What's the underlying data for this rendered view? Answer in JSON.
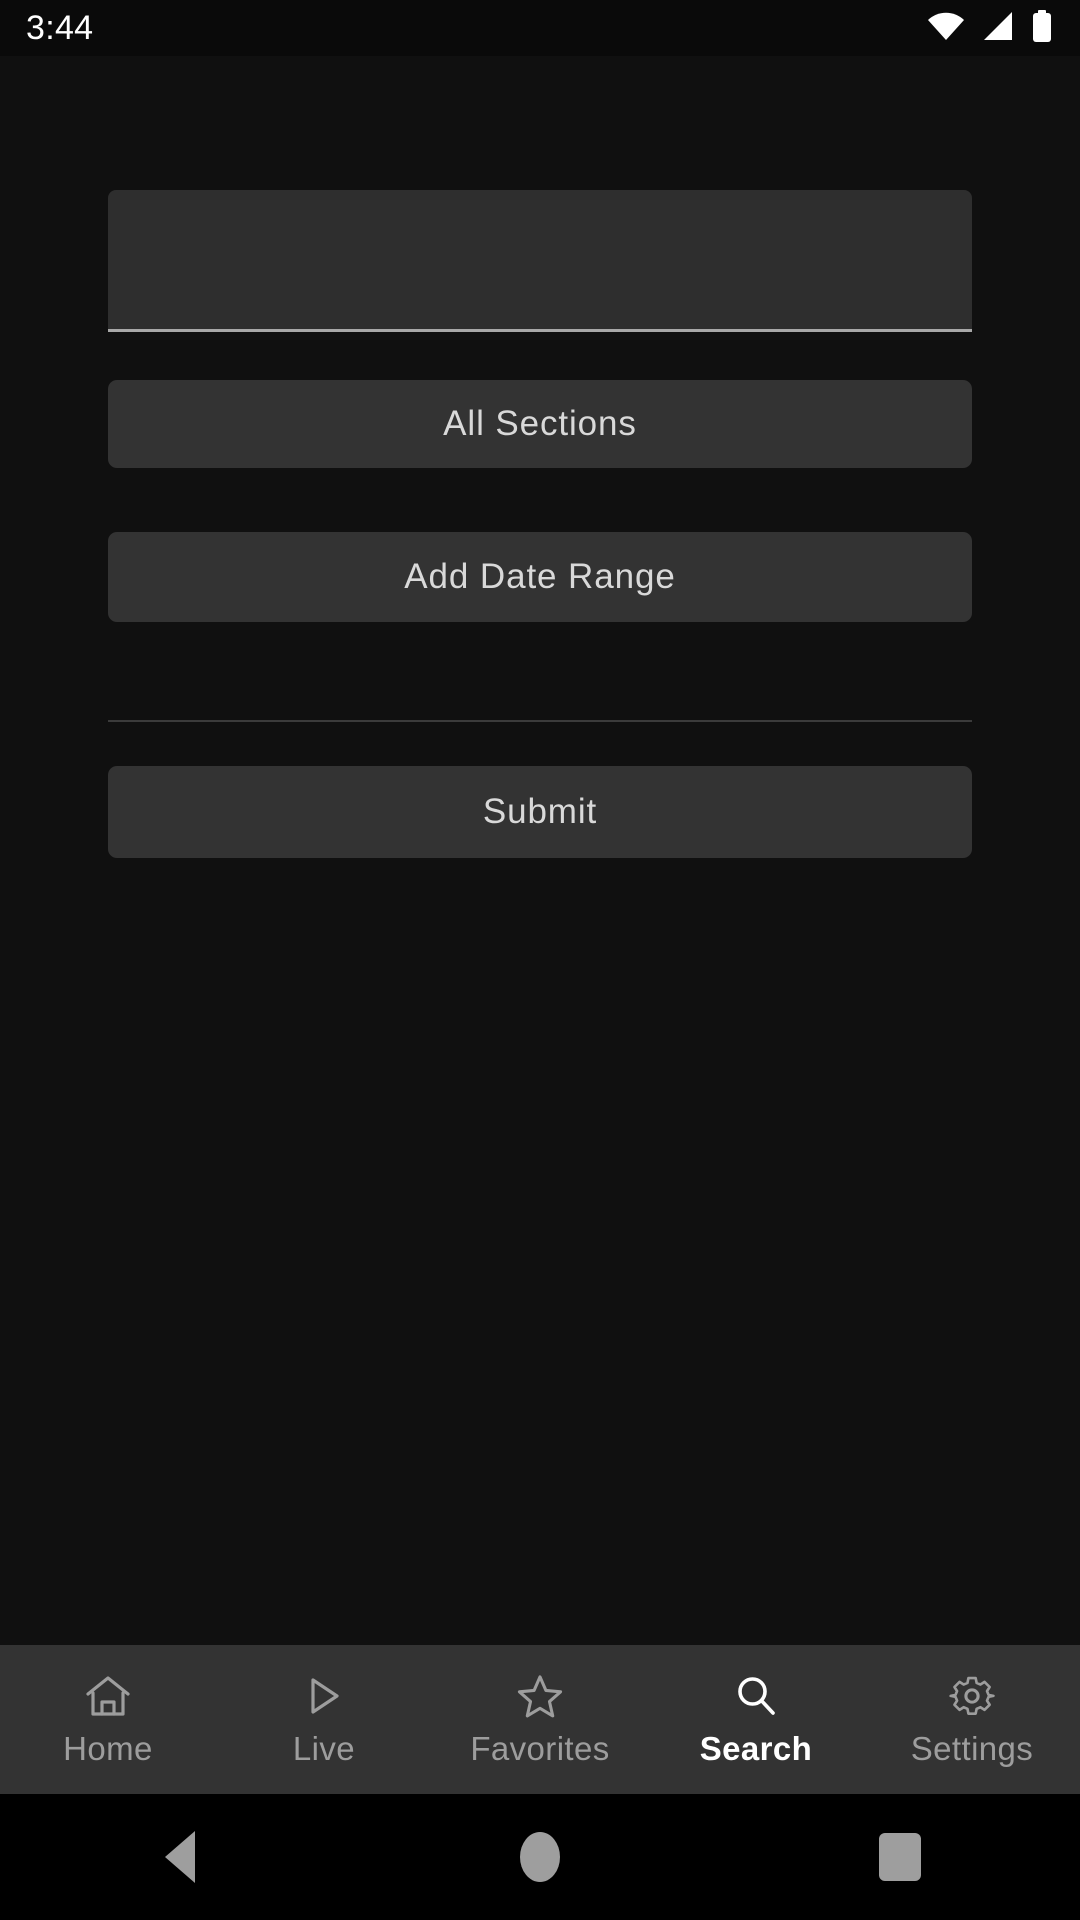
{
  "status_bar": {
    "time": "3:44",
    "icons": [
      "wifi-icon",
      "cellular-signal-icon",
      "battery-icon"
    ]
  },
  "theme": {
    "background": "#101010",
    "surface": "#333333",
    "field_background": "#2e2e2e",
    "field_underline": "#a8a8a8",
    "text_primary": "#d9d9d9",
    "text_inactive": "#9d9d9d",
    "text_active": "#ffffff",
    "divider": "#3b3b3b"
  },
  "search_form": {
    "query_field": {
      "value": "",
      "placeholder": ""
    },
    "sections_button_label": "All Sections",
    "date_range_button_label": "Add Date Range",
    "submit_button_label": "Submit"
  },
  "tab_bar": {
    "active_tab": "Search",
    "items": [
      {
        "label": "Home",
        "icon": "home-icon",
        "active": false
      },
      {
        "label": "Live",
        "icon": "play-icon",
        "active": false
      },
      {
        "label": "Favorites",
        "icon": "star-icon",
        "active": false
      },
      {
        "label": "Search",
        "icon": "search-icon",
        "active": true
      },
      {
        "label": "Settings",
        "icon": "gear-icon",
        "active": false
      }
    ]
  },
  "system_nav": {
    "buttons": [
      {
        "name": "back-button",
        "icon": "triangle-left-icon"
      },
      {
        "name": "home-button",
        "icon": "circle-icon"
      },
      {
        "name": "recents-button",
        "icon": "square-icon"
      }
    ]
  }
}
